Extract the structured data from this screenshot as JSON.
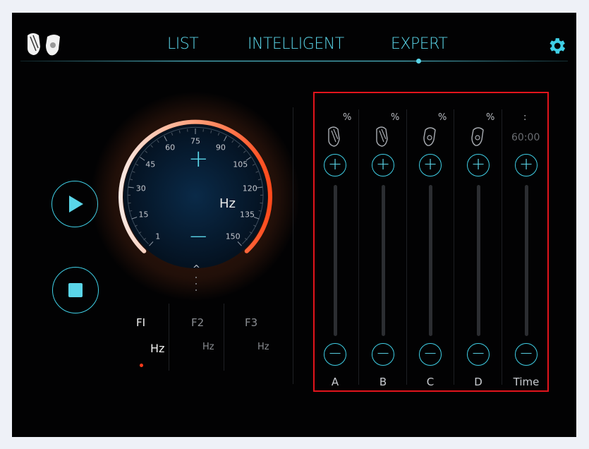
{
  "nav": {
    "tabs": [
      {
        "label": "LIST"
      },
      {
        "label": "INTELLIGENT"
      },
      {
        "label": "EXPERT"
      }
    ],
    "active_tab": "EXPERT"
  },
  "dial": {
    "ticks": [
      "1",
      "15",
      "30",
      "45",
      "60",
      "75",
      "90",
      "105",
      "120",
      "135",
      "150"
    ],
    "unit": "Hz",
    "plus": "+",
    "minus": "−",
    "caret": "^"
  },
  "frequencies": [
    {
      "label": "FI",
      "unit": "Hz",
      "active": true
    },
    {
      "label": "F2",
      "unit": "Hz",
      "active": false
    },
    {
      "label": "F3",
      "unit": "Hz",
      "active": false
    }
  ],
  "channels": [
    {
      "label": "A",
      "pct": "%",
      "icon": "left-earbud-icon"
    },
    {
      "label": "B",
      "pct": "%",
      "icon": "left-earbud-icon"
    },
    {
      "label": "C",
      "pct": "%",
      "icon": "right-earbud-icon"
    },
    {
      "label": "D",
      "pct": "%",
      "icon": "right-earbud-icon"
    }
  ],
  "time": {
    "label": "Time",
    "separator": ":",
    "value": "60:00"
  },
  "buttons": {
    "plus": "+",
    "minus": "−"
  },
  "colors": {
    "accent": "#5ad5e8",
    "highlight": "#e2141c",
    "dial_warm": "#ff5a2a",
    "dial_cool": "#f4d6cc"
  }
}
